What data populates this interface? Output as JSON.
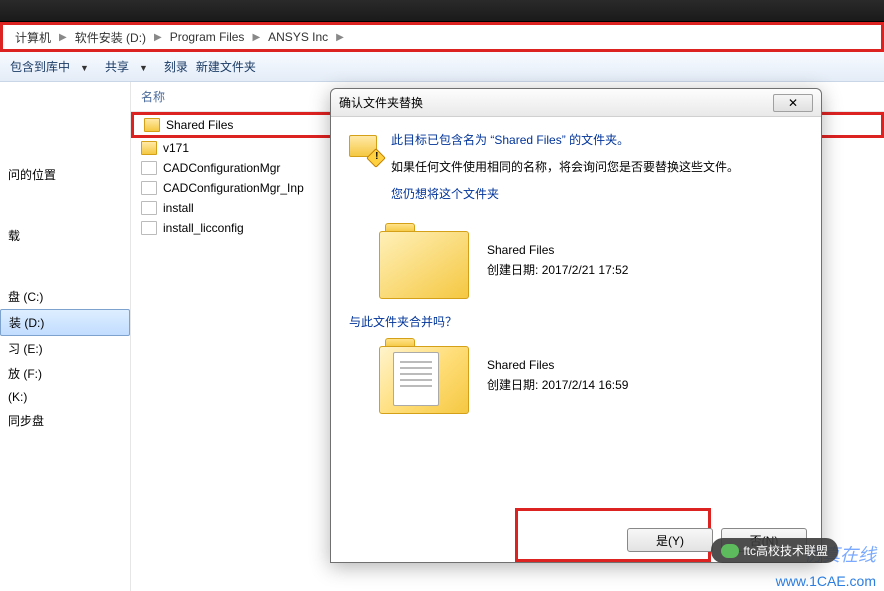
{
  "breadcrumb": {
    "items": [
      "计算机",
      "软件安装 (D:)",
      "Program Files",
      "ANSYS Inc"
    ]
  },
  "toolbar": {
    "include": "包含到库中",
    "share": "共享",
    "burn": "刻录",
    "newfolder": "新建文件夹"
  },
  "columns": {
    "name": "名称"
  },
  "files": [
    {
      "name": "Shared Files",
      "type": "folder"
    },
    {
      "name": "v171",
      "type": "folder"
    },
    {
      "name": "CADConfigurationMgr",
      "type": "file"
    },
    {
      "name": "CADConfigurationMgr_Inp",
      "type": "file"
    },
    {
      "name": "install",
      "type": "file"
    },
    {
      "name": "install_licconfig",
      "type": "file"
    }
  ],
  "nav": {
    "recent": "问的位置",
    "downloads": "载",
    "drives": [
      "盘 (C:)",
      "装 (D:)",
      "习 (E:)",
      "放 (F:)",
      "(K:)",
      "同步盘"
    ]
  },
  "dialog": {
    "title": "确认文件夹替换",
    "line1_pre": "此目标已包含名为",
    "line1_name": "“Shared Files”",
    "line1_post": "的文件夹。",
    "line2": "如果任何文件使用相同的名称，将会询问您是否要替换这些文件。",
    "line3": "您仍想将这个文件夹",
    "merge_q": "与此文件夹合并吗？",
    "folder_a": {
      "name": "Shared Files",
      "date_label": "创建日期:",
      "date": "2017/2/21 17:52"
    },
    "folder_b": {
      "name": "Shared Files",
      "date_label": "创建日期:",
      "date": "2017/2/14 16:59"
    },
    "btn_yes": "是(Y)",
    "btn_no": "否(N)",
    "close_x": "✕"
  },
  "watermark": "1CAE.COM",
  "overlay": {
    "badge": "ftc高校技术联盟",
    "text1": "仿真在线",
    "url": "www.1CAE.com"
  }
}
